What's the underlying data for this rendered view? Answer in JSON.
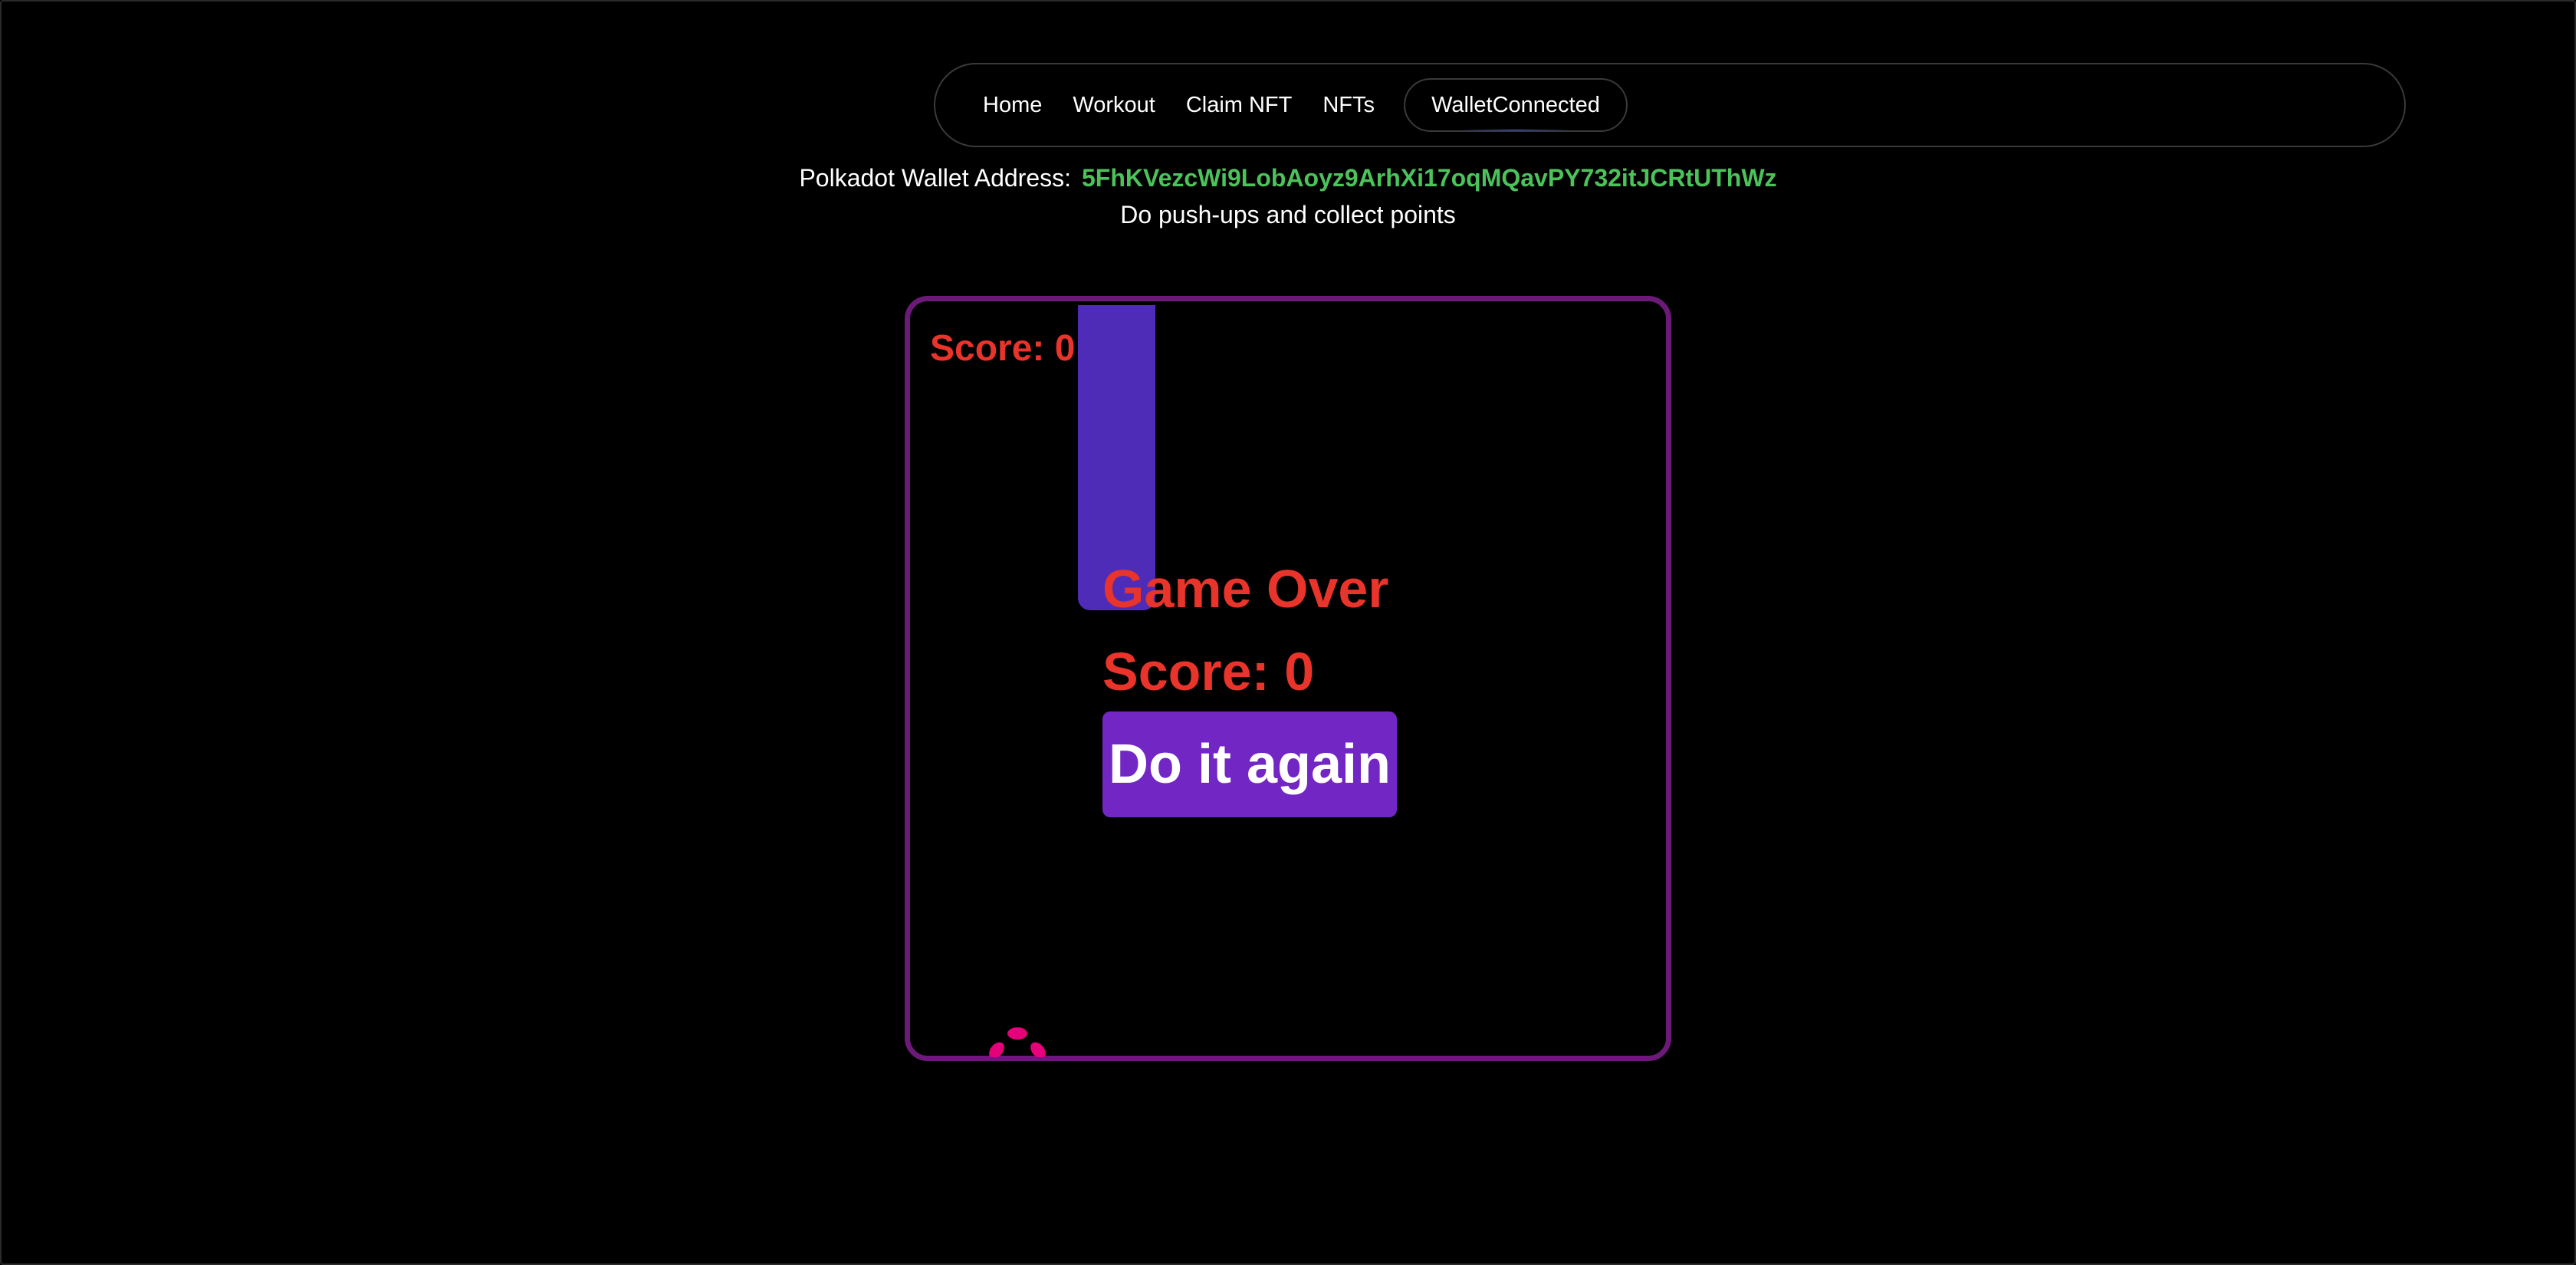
{
  "nav": {
    "items": [
      "Home",
      "Workout",
      "Claim NFT",
      "NFTs"
    ],
    "wallet_button": "WalletConnected"
  },
  "wallet": {
    "label": "Polkadot Wallet Address:",
    "address": "5FhKVezcWi9LobAoyz9ArhXi17oqMQavPY732itJCRtUThWz"
  },
  "subtitle": "Do push-ups and collect points",
  "game": {
    "score_label": "Score: 0",
    "game_over_title": "Game Over",
    "final_score": "Score: 0",
    "retry_button": "Do it again",
    "player_icon": "polkadot-logo-icon"
  },
  "colors": {
    "background": "#000000",
    "accent_green": "#4cc25b",
    "score_red": "#e8342a",
    "game_border": "#6b1a78",
    "obstacle": "#4f2cb8",
    "button_purple": "#7226c4",
    "player_pink": "#e6007a"
  }
}
